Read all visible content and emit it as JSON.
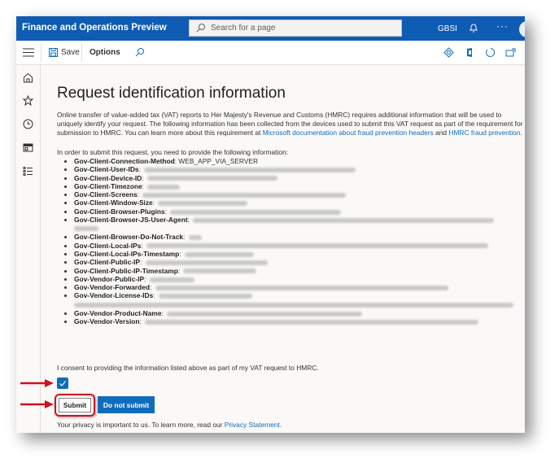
{
  "header": {
    "app_title": "Finance and Operations Preview",
    "search_placeholder": "Search for a page",
    "company": "GBSI",
    "more_label": "···"
  },
  "toolbar": {
    "save_label": "Save",
    "options_label": "Options"
  },
  "icons": {
    "left_nav": [
      "home-icon",
      "star-icon",
      "clock-icon",
      "workspace-icon",
      "list-icon"
    ],
    "toolbar_right": [
      "diamond-icon",
      "office-icon",
      "refresh-icon",
      "open-new-window-icon"
    ]
  },
  "page": {
    "title": "Request identification information",
    "description_prefix": "Online transfer of value-added tax (VAT) reports to Her Majesty's Revenue and Customs (HMRC) requires additional information that will be used to uniquely identify your request. The following information has been collected from the devices used to submit this VAT request as part of the requirement for submission to HMRC. You can learn more about this requirement at ",
    "link_ms_docs": "Microsoft documentation about fraud prevention headers",
    "description_and": " and ",
    "link_hmrc": "HMRC fraud prevention",
    "description_suffix": ".",
    "intro": "In order to submit this request, you need to provide the following information:",
    "fields": [
      {
        "name": "Gov-Client-Connection-Method",
        "value": "WEB_APP_VIA_SERVER"
      },
      {
        "name": "Gov-Client-User-IDs",
        "value": "[redacted]"
      },
      {
        "name": "Gov-Client-Device-ID",
        "value": "[redacted]"
      },
      {
        "name": "Gov-Client-Timezone",
        "value": "[redacted]"
      },
      {
        "name": "Gov-Client-Screens",
        "value": "[redacted]"
      },
      {
        "name": "Gov-Client-Window-Size",
        "value": "[redacted]"
      },
      {
        "name": "Gov-Client-Browser-Plugins",
        "value": "[redacted]"
      },
      {
        "name": "Gov-Client-Browser-JS-User-Agent",
        "value": "[redacted]"
      },
      {
        "name": "Gov-Client-Browser-Do-Not-Track",
        "value": "[redacted]"
      },
      {
        "name": "Gov-Client-Local-IPs",
        "value": "[redacted]"
      },
      {
        "name": "Gov-Client-Local-IPs-Timestamp",
        "value": "[redacted]"
      },
      {
        "name": "Gov-Client-Public-IP",
        "value": "[redacted]"
      },
      {
        "name": "Gov-Client-Public-IP-Timestamp",
        "value": "[redacted]"
      },
      {
        "name": "Gov-Vendor-Public-IP",
        "value": "[redacted]"
      },
      {
        "name": "Gov-Vendor-Forwarded",
        "value": "[redacted]"
      },
      {
        "name": "Gov-Vendor-License-IDs",
        "value": "[redacted]"
      },
      {
        "name": "Gov-Vendor-Product-Name",
        "value": "[redacted]"
      },
      {
        "name": "Gov-Vendor-Version",
        "value": "[redacted]"
      }
    ],
    "consent_text": "I consent to providing the information listed above as part of my VAT request to HMRC.",
    "consent_checked": true,
    "submit_label": "Submit",
    "do_not_submit_label": "Do not submit",
    "privacy_prefix": "Your privacy is important to us. To learn more, read our ",
    "privacy_link": "Privacy Statement",
    "privacy_suffix": "."
  },
  "colors": {
    "brand": "#0f5cb4",
    "accent": "#0f6cbd",
    "annotation_red": "#d10f1e"
  }
}
